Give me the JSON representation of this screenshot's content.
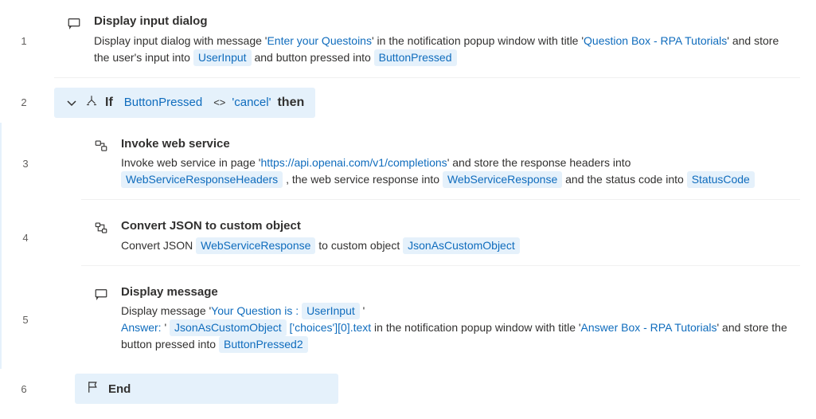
{
  "lines": [
    "1",
    "2",
    "3",
    "4",
    "5",
    "6"
  ],
  "step1": {
    "title": "Display input dialog",
    "d1": "Display input dialog with message '",
    "msg": "Enter your Questoins",
    "d2": "' in the notification popup window with title '",
    "title_str": "Question Box - RPA Tutorials",
    "d3": "' and store the user's input into ",
    "var1": "UserInput",
    "d4": " and button pressed into ",
    "var2": "ButtonPressed"
  },
  "step2_if": {
    "kw_if": "If",
    "var": "ButtonPressed",
    "op": "<>",
    "val": "'cancel'",
    "kw_then": "then"
  },
  "step3": {
    "title": "Invoke web service",
    "d1": "Invoke web service in page '",
    "url": "https://api.openai.com/v1/completions",
    "d2": "' and store the response headers into ",
    "var1": "WebServiceResponseHeaders",
    "d3": " , the web service response into ",
    "var2": "WebServiceResponse",
    "d4": " and the status code into ",
    "var3": "StatusCode"
  },
  "step4": {
    "title": "Convert JSON to custom object",
    "d1": "Convert JSON ",
    "var1": "WebServiceResponse",
    "d2": " to custom object ",
    "var2": "JsonAsCustomObject"
  },
  "step5": {
    "title": "Display message",
    "d1": "Display message '",
    "s1": "Your Question is : ",
    "var1": "UserInput",
    "quote1": " '",
    "s2": "Answer: ",
    "quote2": "' ",
    "var2": "JsonAsCustomObject",
    "path": " ['choices'][0].text",
    "d2": " in the notification popup window with title '",
    "title_str": "Answer Box - RPA Tutorials",
    "d3": "' and store the button pressed into ",
    "var3": "ButtonPressed2"
  },
  "step6_end": {
    "kw": "End"
  }
}
